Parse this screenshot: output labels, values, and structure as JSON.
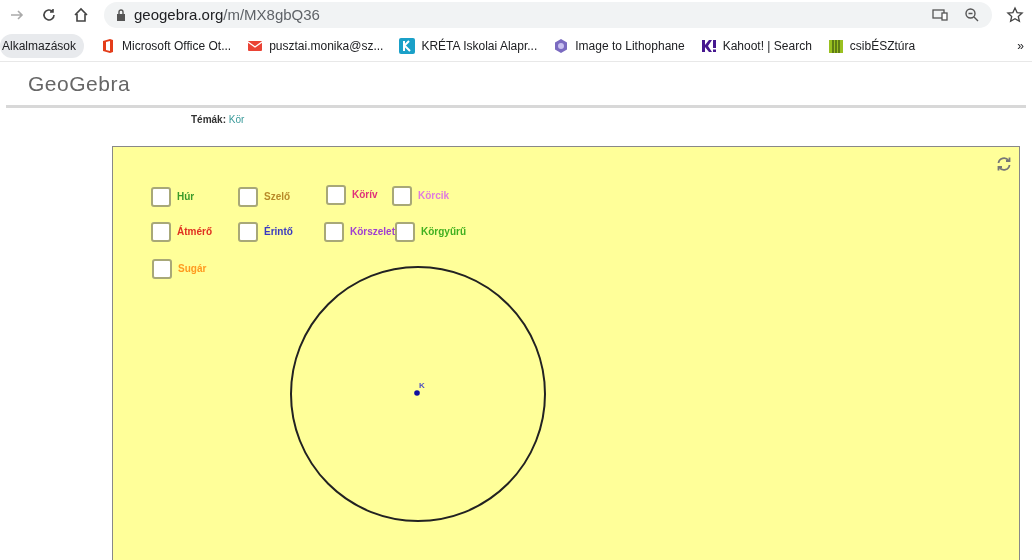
{
  "browser": {
    "url_host": "geogebra.org",
    "url_path": "/m/MX8gbQ36"
  },
  "bookmarks": [
    {
      "label": "Alkalmazások",
      "kind": "apps"
    },
    {
      "label": "Microsoft Office Ot...",
      "kind": "office"
    },
    {
      "label": "pusztai.monika@sz...",
      "kind": "mail"
    },
    {
      "label": "KRÉTA Iskolai Alapr...",
      "kind": "kreta"
    },
    {
      "label": "Image to Lithophane",
      "kind": "litho"
    },
    {
      "label": "Kahoot! | Search",
      "kind": "kahoot"
    },
    {
      "label": "csibÉSZtúra",
      "kind": "csib"
    }
  ],
  "overflow": "»",
  "site": {
    "logo": "GeoGebra",
    "topics_label": "Témák:",
    "topic": "Kör"
  },
  "applet": {
    "checkboxes": [
      {
        "label": "Húr",
        "color": "#3a9a2a",
        "checked": false
      },
      {
        "label": "Szelő",
        "color": "#b88a28",
        "checked": false
      },
      {
        "label": "Körív",
        "color": "#e0307a",
        "checked": false
      },
      {
        "label": "Körcik",
        "color": "#e07be0",
        "checked": false
      },
      {
        "label": "Átmérő",
        "color": "#e03020",
        "checked": false
      },
      {
        "label": "Érintő",
        "color": "#3a3ac0",
        "checked": false
      },
      {
        "label": "Körszelet",
        "color": "#a040d0",
        "checked": false
      },
      {
        "label": "Körgyűrű",
        "color": "#40b020",
        "checked": false
      },
      {
        "label": "Sugár",
        "color": "#ff9a20",
        "checked": false
      }
    ],
    "point_label": "K"
  }
}
